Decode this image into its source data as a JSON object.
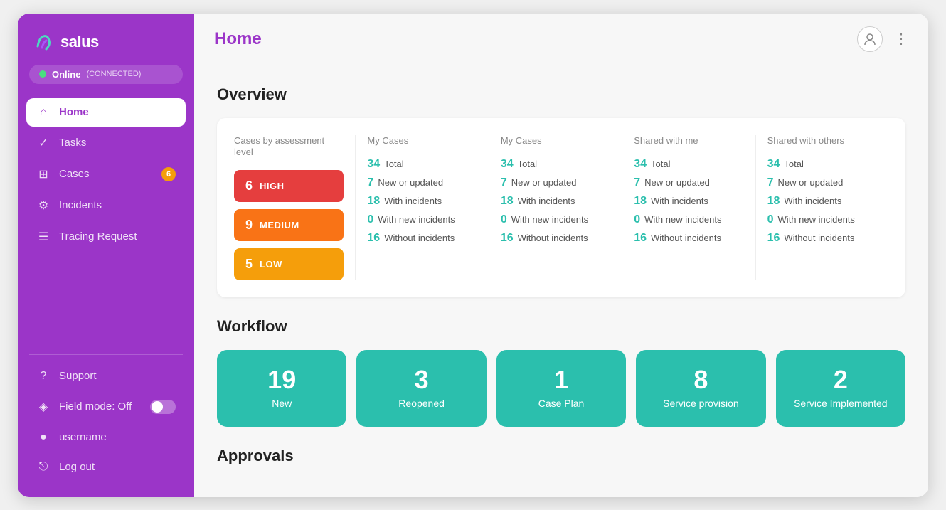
{
  "sidebar": {
    "logo_text": "salus",
    "status": {
      "label": "Online",
      "sub": "(CONNECTED)"
    },
    "nav_items": [
      {
        "id": "home",
        "label": "Home",
        "icon": "⌂",
        "active": true,
        "badge": null
      },
      {
        "id": "tasks",
        "label": "Tasks",
        "icon": "✓",
        "active": false,
        "badge": null
      },
      {
        "id": "cases",
        "label": "Cases",
        "icon": "⊞",
        "active": false,
        "badge": "6"
      },
      {
        "id": "incidents",
        "label": "Incidents",
        "icon": "⚙",
        "active": false,
        "badge": null
      },
      {
        "id": "tracing",
        "label": "Tracing Request",
        "icon": "☰",
        "active": false,
        "badge": null
      }
    ],
    "bottom_items": [
      {
        "id": "support",
        "label": "Support",
        "icon": "?",
        "active": false
      },
      {
        "id": "field-mode",
        "label": "Field mode: Off",
        "icon": "◈",
        "toggle": true
      },
      {
        "id": "username",
        "label": "username",
        "icon": "●",
        "active": false
      },
      {
        "id": "logout",
        "label": "Log out",
        "icon": "⎋",
        "active": false
      }
    ]
  },
  "topbar": {
    "title": "Home",
    "more_icon": "⋮"
  },
  "overview": {
    "section_title": "Overview",
    "columns": [
      {
        "id": "assessment",
        "header": "Cases by assessment level",
        "type": "badges",
        "badges": [
          {
            "level": "HIGH",
            "num": "6",
            "color": "high"
          },
          {
            "level": "MEDIUM",
            "num": "9",
            "color": "medium"
          },
          {
            "level": "LOW",
            "num": "5",
            "color": "low"
          }
        ]
      },
      {
        "id": "my-cases-1",
        "header": "My Cases",
        "type": "stats",
        "stats": [
          {
            "num": "34",
            "label": "Total"
          },
          {
            "num": "7",
            "label": "New or updated"
          },
          {
            "num": "18",
            "label": "With incidents"
          },
          {
            "num": "0",
            "label": "With new incidents"
          },
          {
            "num": "16",
            "label": "Without incidents"
          }
        ]
      },
      {
        "id": "my-cases-2",
        "header": "My Cases",
        "type": "stats",
        "stats": [
          {
            "num": "34",
            "label": "Total"
          },
          {
            "num": "7",
            "label": "New or updated"
          },
          {
            "num": "18",
            "label": "With incidents"
          },
          {
            "num": "0",
            "label": "With new incidents"
          },
          {
            "num": "16",
            "label": "Without incidents"
          }
        ]
      },
      {
        "id": "shared-with-me",
        "header": "Shared with me",
        "type": "stats",
        "stats": [
          {
            "num": "34",
            "label": "Total"
          },
          {
            "num": "7",
            "label": "New or updated"
          },
          {
            "num": "18",
            "label": "With incidents"
          },
          {
            "num": "0",
            "label": "With new incidents"
          },
          {
            "num": "16",
            "label": "Without incidents"
          }
        ]
      },
      {
        "id": "shared-with-others",
        "header": "Shared with others",
        "type": "stats",
        "stats": [
          {
            "num": "34",
            "label": "Total"
          },
          {
            "num": "7",
            "label": "New or updated"
          },
          {
            "num": "18",
            "label": "With incidents"
          },
          {
            "num": "0",
            "label": "With new incidents"
          },
          {
            "num": "16",
            "label": "Without incidents"
          }
        ]
      }
    ]
  },
  "workflow": {
    "section_title": "Workflow",
    "cards": [
      {
        "id": "new",
        "num": "19",
        "label": "New"
      },
      {
        "id": "reopened",
        "num": "3",
        "label": "Reopened"
      },
      {
        "id": "case-plan",
        "num": "1",
        "label": "Case Plan"
      },
      {
        "id": "service-provision",
        "num": "8",
        "label": "Service provision"
      },
      {
        "id": "service-implemented",
        "num": "2",
        "label": "Service Implemented"
      }
    ]
  },
  "approvals": {
    "section_title": "Approvals"
  }
}
